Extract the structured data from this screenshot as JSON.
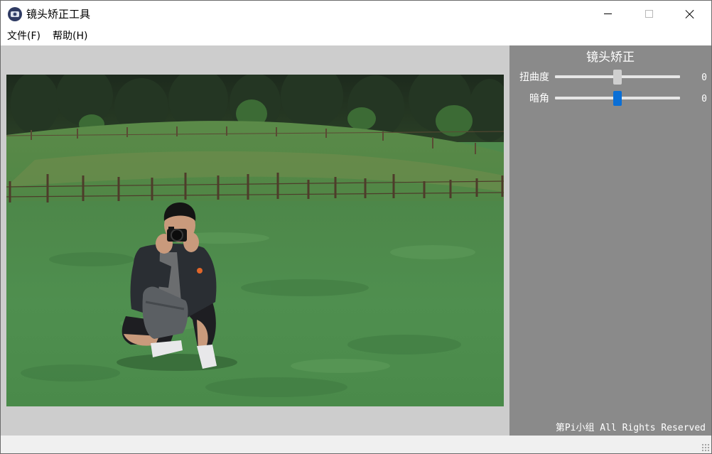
{
  "window": {
    "title": "镜头矫正工具",
    "app_icon": "camera-lens-app-icon",
    "controls": [
      "minimize-icon",
      "maximize-icon",
      "close-icon"
    ]
  },
  "menu": {
    "file": "文件(F)",
    "help": "帮助(H)"
  },
  "preview": {
    "image": "photo of a man crouching on a green meadow, holding a camera to his face, with a wooden fence and forest in the background"
  },
  "panel": {
    "title": "镜头矫正",
    "distortion": {
      "label": "扭曲度",
      "value": "0",
      "level": 0.5,
      "thumb_color": "#cfcfcf"
    },
    "vignette": {
      "label": "暗角",
      "value": "0",
      "level": 0.5,
      "thumb_color": "#0a6fd6"
    },
    "footer": "第Pi小组 All Rights Reserved"
  },
  "colors": {
    "panel_bg": "#8a8a8a",
    "image_area_bg": "#cdcdcd",
    "accent": "#0a6fd6"
  }
}
